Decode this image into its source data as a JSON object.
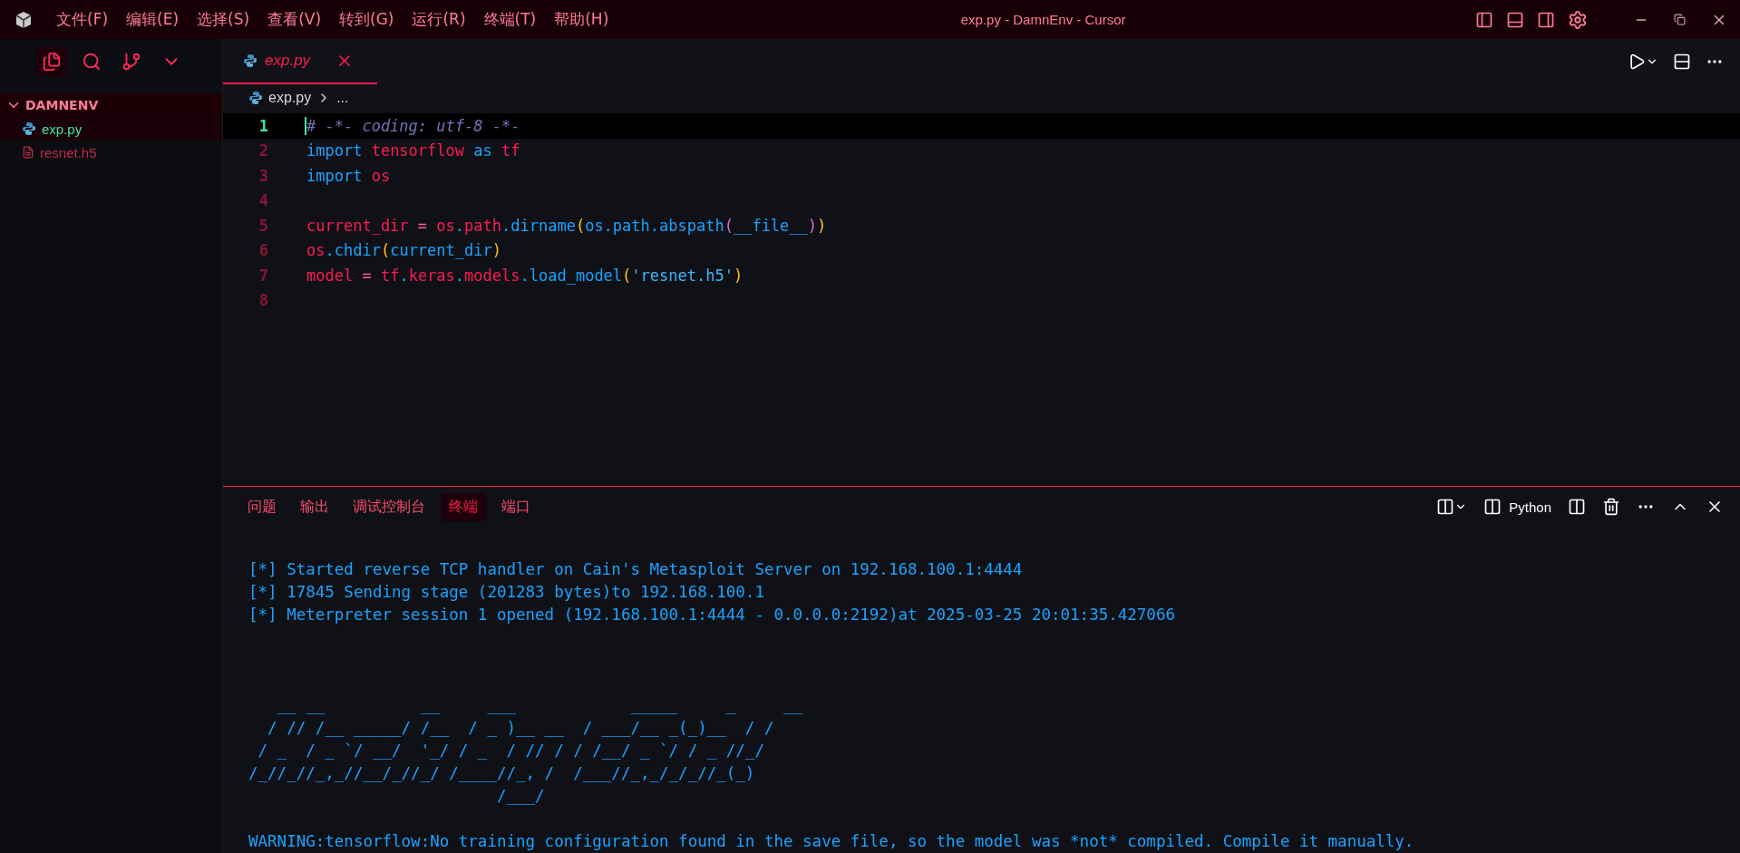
{
  "window": {
    "title": "exp.py - DamnEnv - Cursor"
  },
  "menu": [
    "文件(F)",
    "编辑(E)",
    "选择(S)",
    "查看(V)",
    "转到(G)",
    "运行(R)",
    "终端(T)",
    "帮助(H)"
  ],
  "activity": [
    {
      "kind": "files",
      "selected": true
    },
    {
      "kind": "search",
      "selected": false
    },
    {
      "kind": "git",
      "selected": false
    },
    {
      "kind": "more",
      "selected": false
    }
  ],
  "explorer": {
    "folder": "DAMNENV",
    "expanded": true,
    "files": [
      {
        "name": "exp.py",
        "kind": "python",
        "selected": true
      },
      {
        "name": "resnet.h5",
        "kind": "text",
        "selected": false
      }
    ]
  },
  "tabs": [
    {
      "label": "exp.py",
      "selected": true
    }
  ],
  "breadcrumb": {
    "file": "exp.py",
    "rest": "..."
  },
  "code": [
    {
      "number": "1",
      "current": true,
      "tokens": [
        {
          "kind": "comment",
          "text": "# -*- coding: utf-8 -*-"
        }
      ]
    },
    {
      "number": "2",
      "current": false,
      "tokens": [
        {
          "kind": "keyword",
          "text": "import "
        },
        {
          "kind": "name",
          "text": "tensorflow "
        },
        {
          "kind": "keyword",
          "text": "as "
        },
        {
          "kind": "name",
          "text": "tf"
        }
      ]
    },
    {
      "number": "3",
      "current": false,
      "tokens": [
        {
          "kind": "keyword",
          "text": "import "
        },
        {
          "kind": "name",
          "text": "os"
        }
      ]
    },
    {
      "number": "4",
      "current": false
    },
    {
      "number": "5",
      "current": false,
      "tokens": [
        {
          "kind": "name",
          "text": "current_dir "
        },
        {
          "kind": "operator",
          "text": "= "
        },
        {
          "kind": "name",
          "text": "os"
        },
        {
          "kind": "keyword",
          "text": "."
        },
        {
          "kind": "name",
          "text": "path"
        },
        {
          "kind": "keyword",
          "text": ".dirname"
        },
        {
          "kind": "paren",
          "text": "("
        },
        {
          "kind": "keyword",
          "text": "os.path.abspath"
        },
        {
          "kind": "paren2",
          "text": "("
        },
        {
          "kind": "keyword",
          "text": "__file__"
        },
        {
          "kind": "paren2",
          "text": ")"
        },
        {
          "kind": "paren",
          "text": ")"
        }
      ]
    },
    {
      "number": "6",
      "current": false,
      "tokens": [
        {
          "kind": "name",
          "text": "os"
        },
        {
          "kind": "keyword",
          "text": ".chdir"
        },
        {
          "kind": "paren",
          "text": "("
        },
        {
          "kind": "keyword",
          "text": "current_dir"
        },
        {
          "kind": "paren",
          "text": ")"
        }
      ]
    },
    {
      "number": "7",
      "current": false,
      "tokens": [
        {
          "kind": "name",
          "text": "model "
        },
        {
          "kind": "operator",
          "text": "= "
        },
        {
          "kind": "name",
          "text": "tf"
        },
        {
          "kind": "keyword",
          "text": "."
        },
        {
          "kind": "name",
          "text": "keras"
        },
        {
          "kind": "keyword",
          "text": "."
        },
        {
          "kind": "name",
          "text": "models"
        },
        {
          "kind": "keyword",
          "text": ".load_model"
        },
        {
          "kind": "paren",
          "text": "("
        },
        {
          "kind": "string",
          "text": "'resnet.h5'"
        },
        {
          "kind": "paren",
          "text": ")"
        }
      ]
    },
    {
      "number": "8",
      "current": false
    }
  ],
  "panel": {
    "tabs": [
      {
        "label": "问题",
        "selected": false
      },
      {
        "label": "输出",
        "selected": false
      },
      {
        "label": "调试控制台",
        "selected": false
      },
      {
        "label": "终端",
        "selected": true
      },
      {
        "label": "端口",
        "selected": false
      }
    ],
    "shell": "Python"
  },
  "terminal": [
    {
      "kind": "blank"
    },
    {
      "kind": "text",
      "text": "[*] Started reverse TCP handler on Cain's Metasploit Server on 192.168.100.1:4444"
    },
    {
      "kind": "text",
      "text": "[*] 17845 Sending stage (201283 bytes)to 192.168.100.1"
    },
    {
      "kind": "text",
      "text": "[*] Meterpreter session 1 opened (192.168.100.1:4444 - 0.0.0.0:2192)at 2025-03-25 20:01:35.427066"
    },
    {
      "kind": "blank"
    },
    {
      "kind": "blank"
    },
    {
      "kind": "blank"
    },
    {
      "kind": "text",
      "text": "   __ __          __     ___            _____     _     __"
    },
    {
      "kind": "text",
      "text": "  / // /__ _____/ /__  / _ )__ __  / ___/__ _(_)__  / /"
    },
    {
      "kind": "text",
      "text": " / _  / _ `/ __/  '_/ / _  / // / / /__/ _ `/ / _ //_/"
    },
    {
      "kind": "text",
      "text": "/_//_//_,_//__/_//_/ /____//_, /  /___//_,_/_/_//_(_)"
    },
    {
      "kind": "text",
      "text": "                          /___/"
    },
    {
      "kind": "blank"
    },
    {
      "kind": "text",
      "text": "WARNING:tensorflow:No training configuration found in the save file, so the model was *not* compiled. Compile it manually."
    }
  ]
}
